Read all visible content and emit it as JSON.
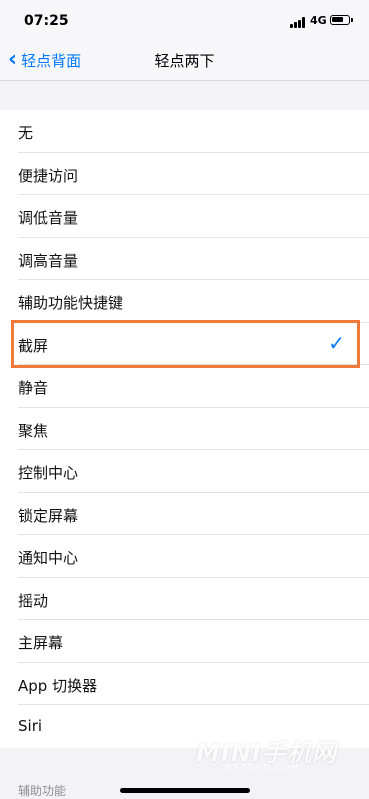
{
  "status_bar": {
    "time": "07:25",
    "network": "4G",
    "battery_level": 0.7
  },
  "navbar": {
    "back_label": "轻点背面",
    "title": "轻点两下"
  },
  "options": [
    {
      "label": "无",
      "selected": false
    },
    {
      "label": "便捷访问",
      "selected": false
    },
    {
      "label": "调低音量",
      "selected": false
    },
    {
      "label": "调高音量",
      "selected": false
    },
    {
      "label": "辅助功能快捷键",
      "selected": false
    },
    {
      "label": "截屏",
      "selected": true
    },
    {
      "label": "静音",
      "selected": false
    },
    {
      "label": "聚焦",
      "selected": false
    },
    {
      "label": "控制中心",
      "selected": false
    },
    {
      "label": "锁定屏幕",
      "selected": false
    },
    {
      "label": "通知中心",
      "selected": false
    },
    {
      "label": "摇动",
      "selected": false
    },
    {
      "label": "主屏幕",
      "selected": false
    },
    {
      "label": "App 切换器",
      "selected": false
    },
    {
      "label": "Siri",
      "selected": false
    }
  ],
  "checkmark": "✓",
  "footer": {
    "section_label": "辅助功能"
  },
  "watermark": {
    "text": "MINI手机网",
    "sub": "NETDEO.COM"
  },
  "colors": {
    "accent": "#007aff",
    "highlight": "#f07a3a"
  }
}
